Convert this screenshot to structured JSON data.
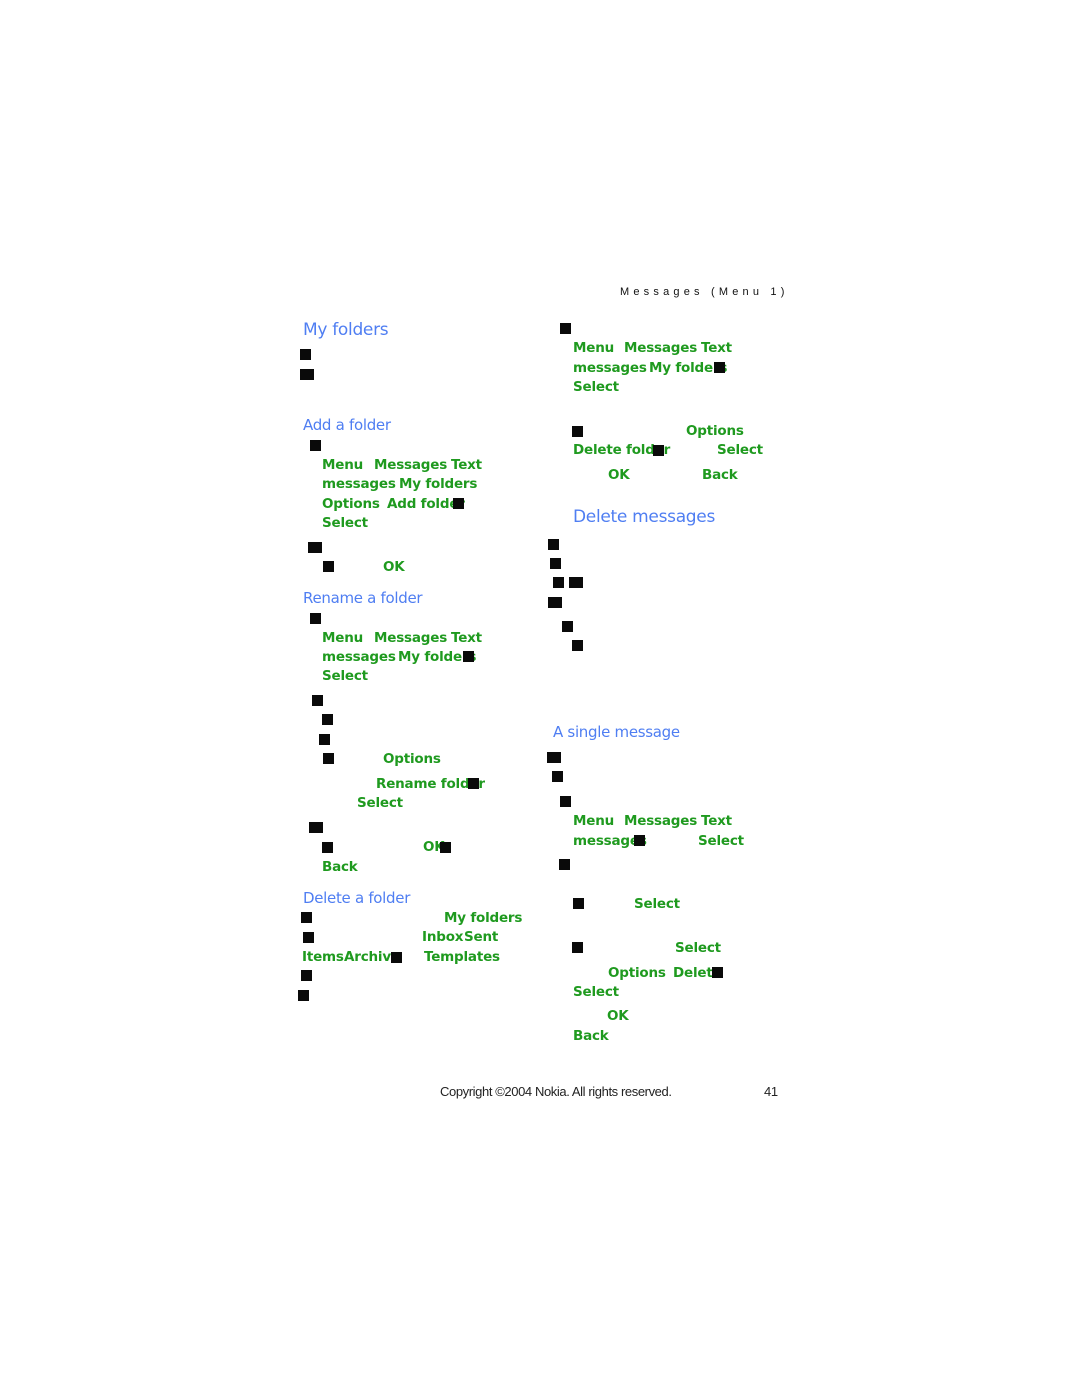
{
  "running_head": "Messages (Menu 1)",
  "left_column": {
    "my_folders": {
      "title": "My folders"
    },
    "add_folder": {
      "title": "Add a folder",
      "path_line1": [
        "Menu",
        "Messages",
        "Text"
      ],
      "path_line2": [
        "messages",
        "My folders"
      ],
      "path_line3": [
        "Options",
        "Add folder"
      ],
      "select": "Select",
      "ok": "OK"
    },
    "rename_folder": {
      "title": "Rename a folder",
      "path_line1": [
        "Menu",
        "Messages",
        "Text"
      ],
      "path_line2": [
        "messages",
        "My folders"
      ],
      "select": "Select",
      "options": "Options",
      "rename_folder": "Rename folder",
      "select2": "Select",
      "ok": "OK",
      "back": "Back"
    },
    "delete_folder": {
      "title": "Delete a folder",
      "my_folders": "My folders",
      "inbox": "Inbox",
      "sent": "Sent",
      "items": "Items",
      "archive": "Archive",
      "templates": "Templates"
    }
  },
  "right_column": {
    "delete_folder_cont": {
      "path_line1": [
        "Menu",
        "Messages",
        "Text"
      ],
      "path_line2": [
        "messages",
        "My folders"
      ],
      "select": "Select",
      "options": "Options",
      "delete_folder": "Delete folder",
      "select2": "Select",
      "ok": "OK",
      "back": "Back"
    },
    "delete_messages": {
      "title": "Delete messages"
    },
    "single_message": {
      "title": "A single message",
      "path_line1": [
        "Menu",
        "Messages",
        "Text"
      ],
      "path_line2": [
        "messages"
      ],
      "select": "Select",
      "select2": "Select",
      "select3": "Select",
      "options": "Options",
      "delete": "Delete",
      "select4": "Select",
      "ok": "OK",
      "back": "Back"
    }
  },
  "footer": {
    "copyright": "Copyright ©2004 Nokia. All rights reserved.",
    "page_number": "41"
  }
}
